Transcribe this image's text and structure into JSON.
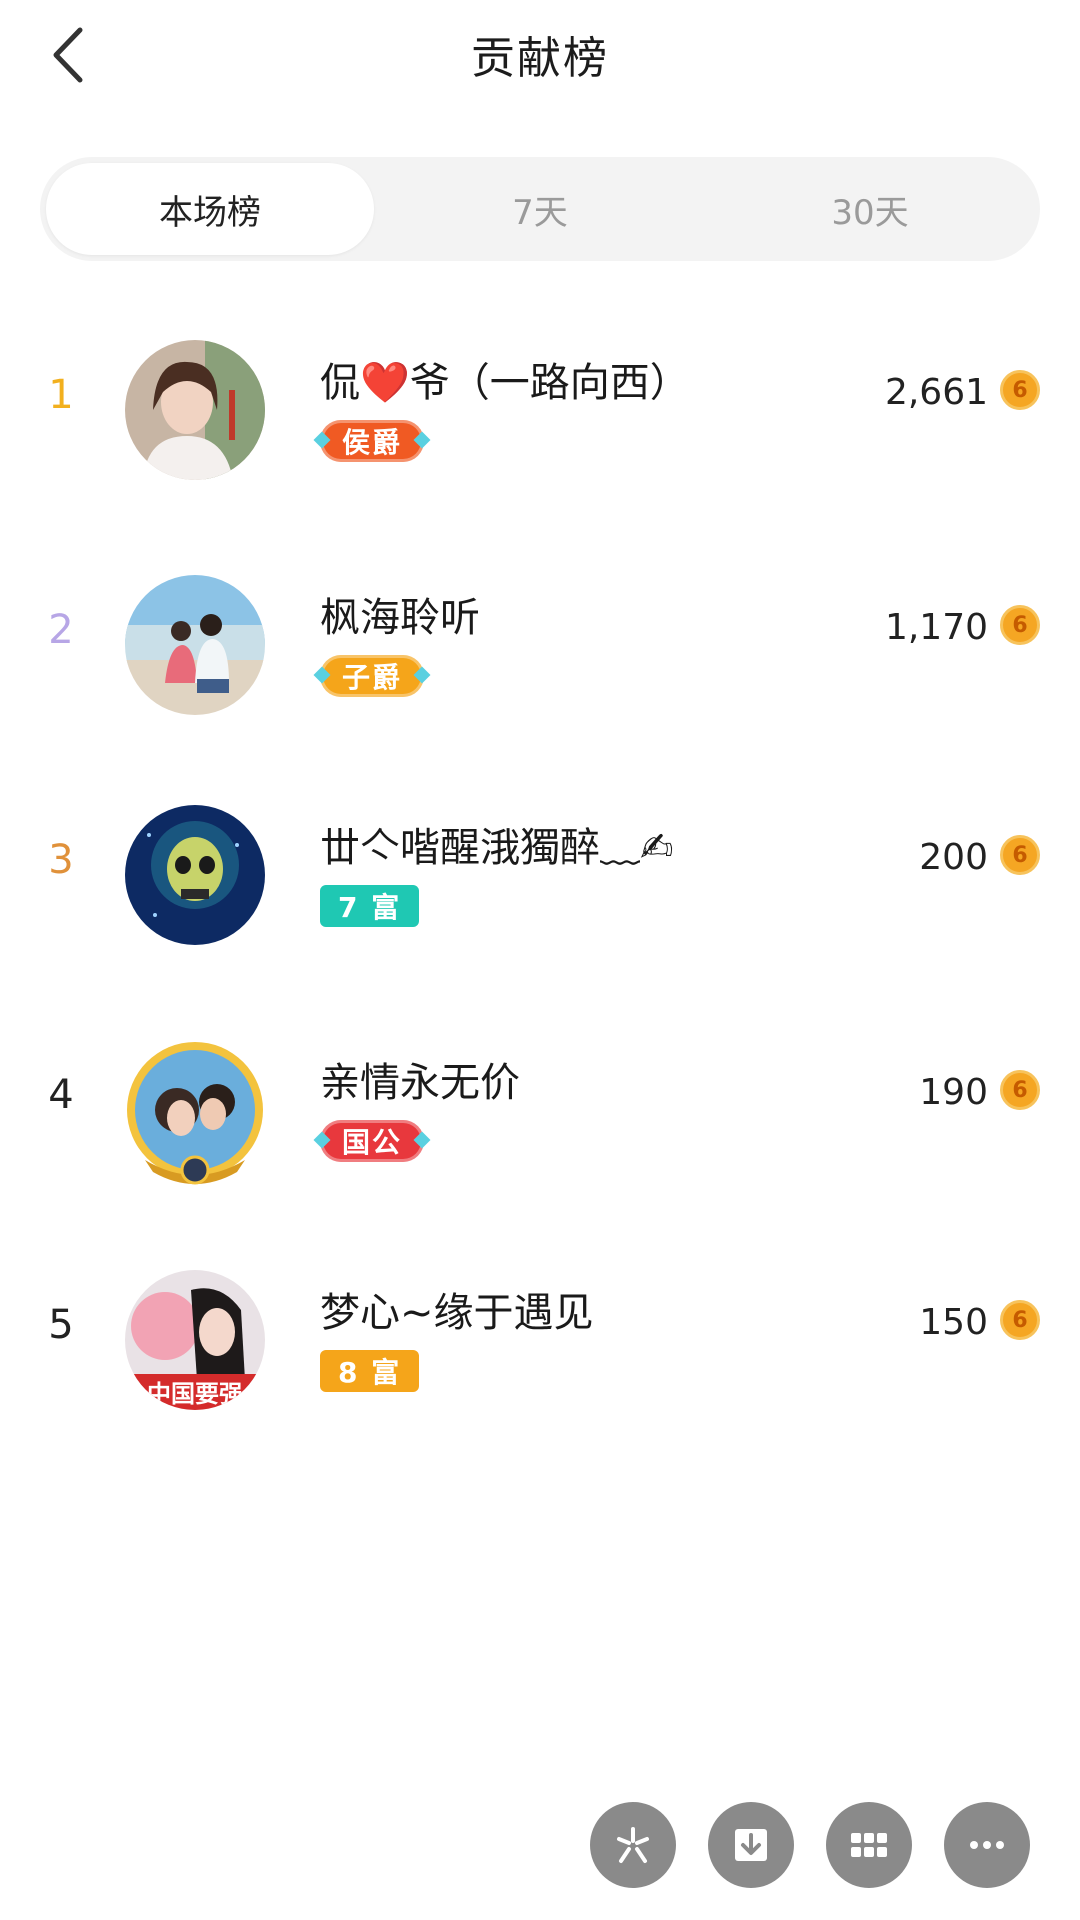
{
  "header": {
    "title": "贡献榜"
  },
  "tabs": [
    {
      "label": "本场榜",
      "active": true
    },
    {
      "label": "7天",
      "active": false
    },
    {
      "label": "30天",
      "active": false
    }
  ],
  "rank_colors": {
    "1": "#f2b01e",
    "2": "#b7a6e6",
    "3": "#e0913a",
    "default": "#222222"
  },
  "rows": [
    {
      "rank": "1",
      "name": "侃❤️爷（一路向西）",
      "badge": "侯爵",
      "badge_type": "noble",
      "badge_color": "#f05a23",
      "score": "2,661"
    },
    {
      "rank": "2",
      "name": "枫海聆听",
      "badge": "子爵",
      "badge_type": "noble",
      "badge_color": "#f5a51a",
      "score": "1,170"
    },
    {
      "rank": "3",
      "name": "丗亽喈醒涐獨醉﹏✍",
      "badge": "7 富",
      "badge_type": "wealth",
      "badge_color": "#1fc8b3",
      "score": "200"
    },
    {
      "rank": "4",
      "name": "亲情永无价",
      "badge": "国公",
      "badge_type": "noble",
      "badge_color": "#e8383d",
      "score": "190"
    },
    {
      "rank": "5",
      "name": "梦心~缘于遇见",
      "badge": "8 富",
      "badge_type": "wealth",
      "badge_color": "#f5a51a",
      "score": "150"
    }
  ],
  "coin_glyph": "6",
  "avatar_5_caption": "中国要强",
  "fabs": [
    {
      "icon": "share-icon"
    },
    {
      "icon": "download-icon"
    },
    {
      "icon": "grid-icon"
    },
    {
      "icon": "more-icon"
    }
  ]
}
